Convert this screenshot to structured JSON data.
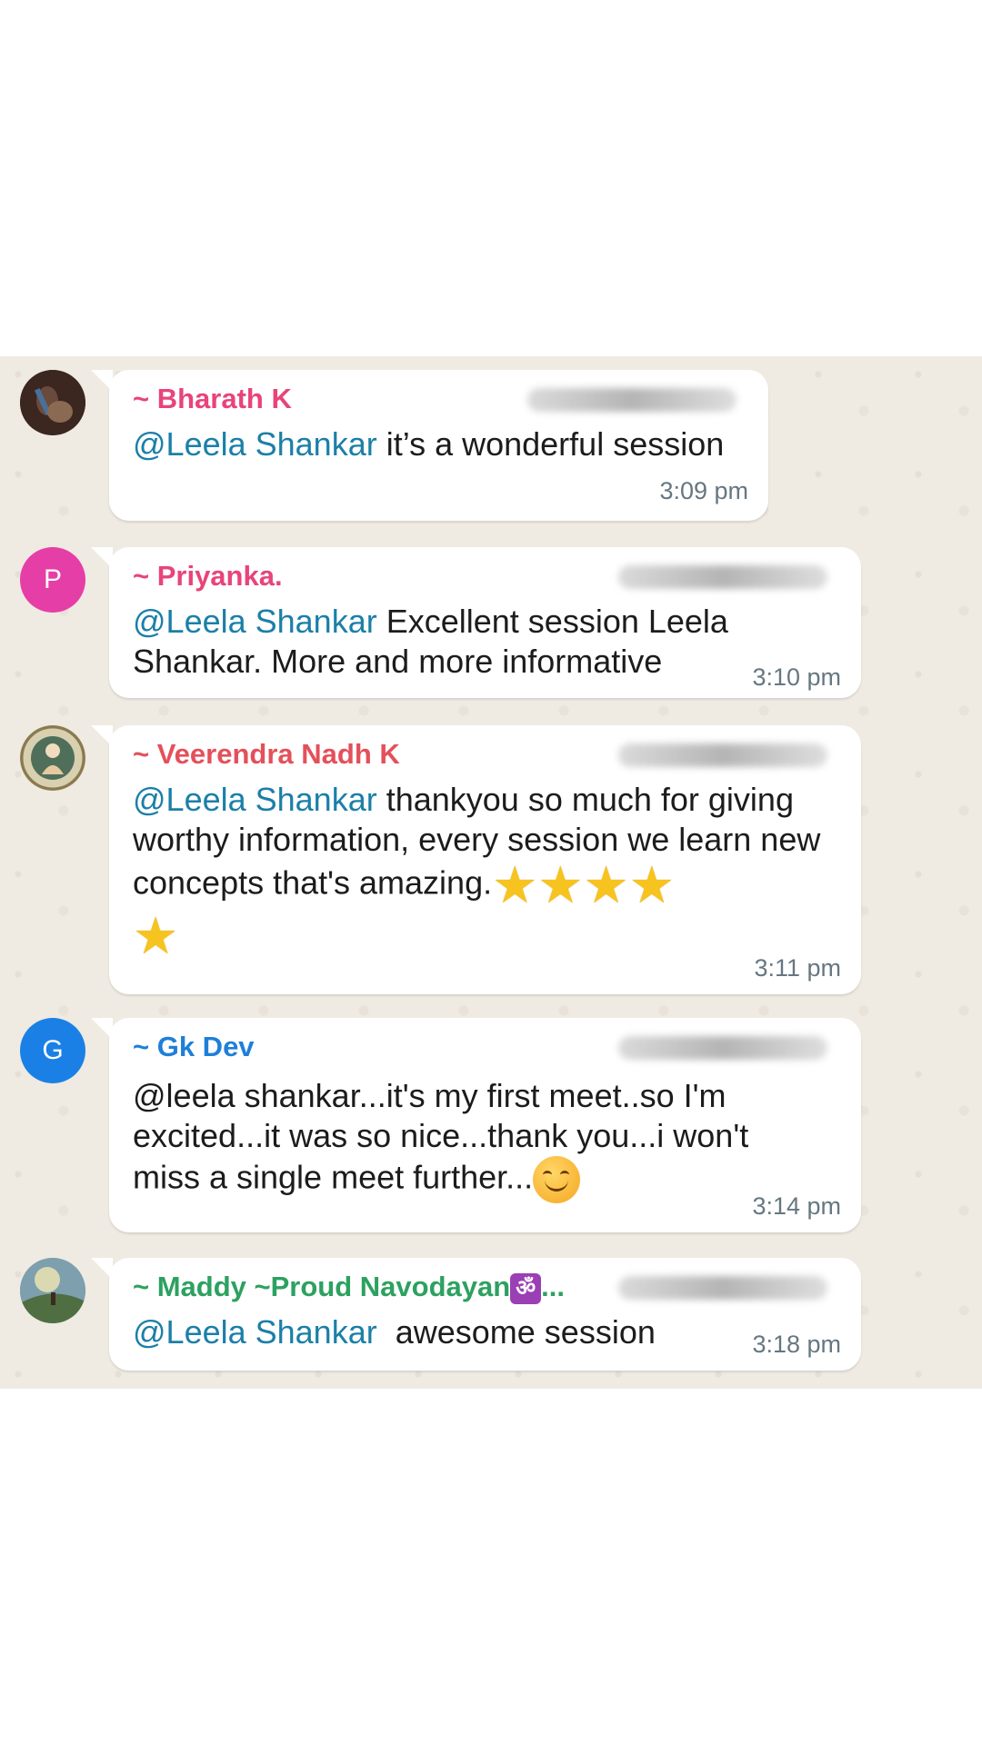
{
  "messages": [
    {
      "sender": "~ Bharath K",
      "sender_color": "#e8447a",
      "mention": "@Leela Shankar",
      "text": " it’s a wonderful session",
      "time": "3:09 pm"
    },
    {
      "sender": "~ Priyanka.",
      "sender_color": "#e8447a",
      "avatar_letter": "P",
      "avatar_color": "#e63ea7",
      "mention": "@Leela Shankar",
      "text": " Excellent session Leela Shankar. More and more informative",
      "time": "3:10 pm"
    },
    {
      "sender": "~ Veerendra Nadh K",
      "sender_color": "#e4505a",
      "mention": "@Leela Shankar",
      "text": " thankyou so much for giving worthy information, every session we learn new concepts that's amazing.",
      "emoji_names": [
        "star-icon",
        "star-icon",
        "star-icon",
        "star-icon",
        "star-icon"
      ],
      "time": "3:11 pm"
    },
    {
      "sender": "~ Gk Dev",
      "sender_color": "#1f7fd8",
      "avatar_letter": "G",
      "avatar_color": "#1a80e6",
      "text": "@leela shankar...it's my first meet..so I'm excited...it was so nice...thank you...i won't miss a single meet further...",
      "emoji_names": [
        "smiling-face-icon"
      ],
      "time": "3:14 pm"
    },
    {
      "sender": "~ Maddy ~Proud Navodayan",
      "sender_suffix": "...",
      "sender_emoji": "om-symbol-icon",
      "sender_color": "#2da160",
      "mention": "@Leela Shankar",
      "text": "  awesome session",
      "time": "3:18 pm"
    }
  ]
}
